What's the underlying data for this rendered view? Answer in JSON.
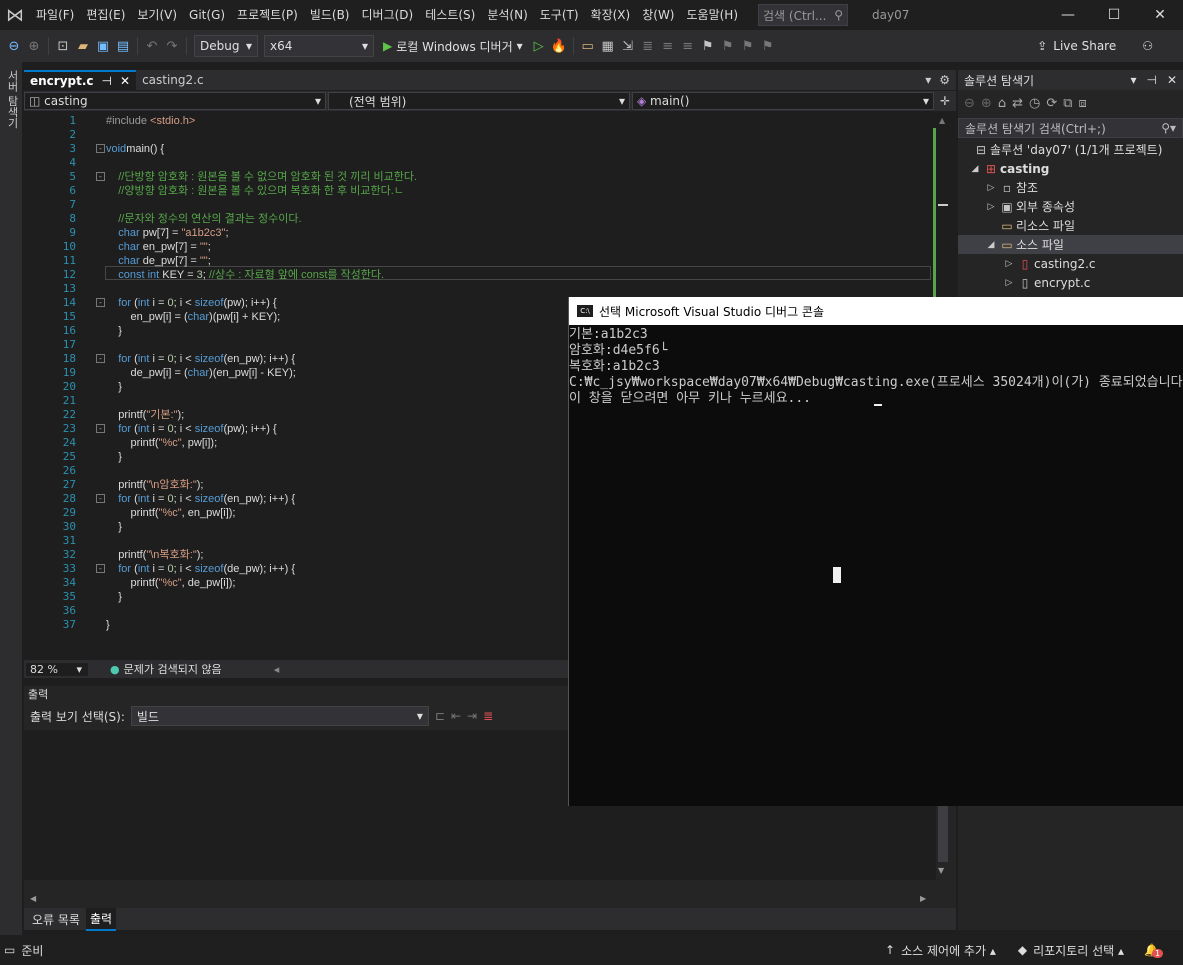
{
  "menubar": {
    "items": [
      "파일(F)",
      "편집(E)",
      "보기(V)",
      "Git(G)",
      "프로젝트(P)",
      "빌드(B)",
      "디버그(D)",
      "테스트(S)",
      "분석(N)",
      "도구(T)",
      "확장(X)",
      "창(W)",
      "도움말(H)"
    ],
    "search_label": "검색 (Ctrl...",
    "solution_title": "day07",
    "minimize": "—",
    "maximize": "☐",
    "close": "✕"
  },
  "toolbar": {
    "config": "Debug",
    "platform": "x64",
    "run_label": "로컬 Windows 디버거",
    "live_share": "Live Share"
  },
  "left_rail": {
    "label": "서버 탐색기"
  },
  "editor": {
    "tabs": [
      {
        "label": "encrypt.c",
        "pin": "⊣",
        "close": "✕"
      },
      {
        "label": "casting2.c"
      }
    ],
    "nav": {
      "project": "casting",
      "scope": "(전역 범위)",
      "member": "main()"
    },
    "zoom": "82 %",
    "status": "문제가 검색되지 않음",
    "lines": [
      [
        [
          "pp",
          "#include "
        ],
        [
          "str",
          "<stdio.h>"
        ]
      ],
      [],
      [
        [
          "kw",
          "void"
        ],
        [
          "",
          "main() {"
        ]
      ],
      [],
      [
        [
          "cm",
          "    //단방향 암호화 : 원본을 볼 수 없으며 암호화 된 것 끼리 비교한다."
        ]
      ],
      [
        [
          "cm",
          "    //양방향 암호화 : 원본을 볼 수 있으며 복호화 한 후 비교한다.ㄴ"
        ]
      ],
      [],
      [
        [
          "cm",
          "    //문자와 정수의 연산의 결과는 정수이다."
        ]
      ],
      [
        [
          "",
          "    "
        ],
        [
          "kw",
          "char"
        ],
        [
          "",
          " pw[7] = "
        ],
        [
          "str",
          "\"a1b2c3\""
        ],
        [
          "",
          ";"
        ]
      ],
      [
        [
          "",
          "    "
        ],
        [
          "kw",
          "char"
        ],
        [
          "",
          " en_pw[7] = "
        ],
        [
          "str",
          "\"\""
        ],
        [
          "",
          ";"
        ]
      ],
      [
        [
          "",
          "    "
        ],
        [
          "kw",
          "char"
        ],
        [
          "",
          " de_pw[7] = "
        ],
        [
          "str",
          "\"\""
        ],
        [
          "",
          ";"
        ]
      ],
      [
        [
          "",
          "    "
        ],
        [
          "kw",
          "const int"
        ],
        [
          "",
          " KEY = "
        ],
        [
          "num",
          "3"
        ],
        [
          "",
          "; "
        ],
        [
          "cm",
          "//상수 : 자료형 앞에 const를 작성한다."
        ]
      ],
      [],
      [
        [
          "",
          "    "
        ],
        [
          "kw",
          "for"
        ],
        [
          "",
          " ("
        ],
        [
          "kw",
          "int"
        ],
        [
          "",
          " i = "
        ],
        [
          "num",
          "0"
        ],
        [
          "",
          "; i < "
        ],
        [
          "kw",
          "sizeof"
        ],
        [
          "",
          "(pw); i++) {"
        ]
      ],
      [
        [
          "",
          "        en_pw[i] = ("
        ],
        [
          "kw",
          "char"
        ],
        [
          "",
          ")(pw[i] + KEY);"
        ]
      ],
      [
        [
          "",
          "    }"
        ]
      ],
      [],
      [
        [
          "",
          "    "
        ],
        [
          "kw",
          "for"
        ],
        [
          "",
          " ("
        ],
        [
          "kw",
          "int"
        ],
        [
          "",
          " i = "
        ],
        [
          "num",
          "0"
        ],
        [
          "",
          "; i < "
        ],
        [
          "kw",
          "sizeof"
        ],
        [
          "",
          "(en_pw); i++) {"
        ]
      ],
      [
        [
          "",
          "        de_pw[i] = ("
        ],
        [
          "kw",
          "char"
        ],
        [
          "",
          ")(en_pw[i] - KEY);"
        ]
      ],
      [
        [
          "",
          "    }"
        ]
      ],
      [],
      [
        [
          "",
          "    printf("
        ],
        [
          "str",
          "\"기본:\""
        ],
        [
          "",
          ");"
        ]
      ],
      [
        [
          "",
          "    "
        ],
        [
          "kw",
          "for"
        ],
        [
          "",
          " ("
        ],
        [
          "kw",
          "int"
        ],
        [
          "",
          " i = "
        ],
        [
          "num",
          "0"
        ],
        [
          "",
          "; i < "
        ],
        [
          "kw",
          "sizeof"
        ],
        [
          "",
          "(pw); i++) {"
        ]
      ],
      [
        [
          "",
          "        printf("
        ],
        [
          "str",
          "\"%c\""
        ],
        [
          "",
          ", pw[i]);"
        ]
      ],
      [
        [
          "",
          "    }"
        ]
      ],
      [],
      [
        [
          "",
          "    printf("
        ],
        [
          "str",
          "\"\\n암호화:\""
        ],
        [
          "",
          ");"
        ]
      ],
      [
        [
          "",
          "    "
        ],
        [
          "kw",
          "for"
        ],
        [
          "",
          " ("
        ],
        [
          "kw",
          "int"
        ],
        [
          "",
          " i = "
        ],
        [
          "num",
          "0"
        ],
        [
          "",
          "; i < "
        ],
        [
          "kw",
          "sizeof"
        ],
        [
          "",
          "(en_pw); i++) {"
        ]
      ],
      [
        [
          "",
          "        printf("
        ],
        [
          "str",
          "\"%c\""
        ],
        [
          "",
          ", en_pw[i]);"
        ]
      ],
      [
        [
          "",
          "    }"
        ]
      ],
      [],
      [
        [
          "",
          "    printf("
        ],
        [
          "str",
          "\"\\n복호화:\""
        ],
        [
          "",
          ");"
        ]
      ],
      [
        [
          "",
          "    "
        ],
        [
          "kw",
          "for"
        ],
        [
          "",
          " ("
        ],
        [
          "kw",
          "int"
        ],
        [
          "",
          " i = "
        ],
        [
          "num",
          "0"
        ],
        [
          "",
          "; i < "
        ],
        [
          "kw",
          "sizeof"
        ],
        [
          "",
          "(de_pw); i++) {"
        ]
      ],
      [
        [
          "",
          "        printf("
        ],
        [
          "str",
          "\"%c\""
        ],
        [
          "",
          ", de_pw[i]);"
        ]
      ],
      [
        [
          "",
          "    }"
        ]
      ],
      [],
      [
        [
          "",
          "}"
        ]
      ]
    ]
  },
  "output": {
    "title": "출력",
    "select_label": "출력 보기 선택(S):",
    "select_value": "빌드"
  },
  "bottom_tabs": [
    "오류 목록",
    "출력"
  ],
  "solution_explorer": {
    "title": "솔루션 탐색기",
    "search": "솔루션 탐색기 검색(Ctrl+;)",
    "solution": "솔루션 'day07' (1/1개 프로젝트)",
    "project": "casting",
    "nodes": [
      "참조",
      "외부 종속성",
      "리소스 파일",
      "소스 파일",
      "casting2.c",
      "encrypt.c"
    ]
  },
  "console": {
    "title": "선택 Microsoft Visual Studio 디버그 콘솔",
    "icon": "C:\\",
    "lines": [
      "기본:a1b2c3",
      "암호화:d4e5f6└",
      "복호화:a1b2c3",
      "C:₩c_jsy₩workspace₩day07₩x64₩Debug₩casting.exe(프로세스 35024개)이(가) 종료되었습니다",
      "이 창을 닫으려면 아무 키나 누르세요..."
    ]
  },
  "statusbar": {
    "ready": "준비",
    "source_control": "소스 제어에 추가",
    "repo": "리포지토리 선택",
    "notifications": "1"
  }
}
